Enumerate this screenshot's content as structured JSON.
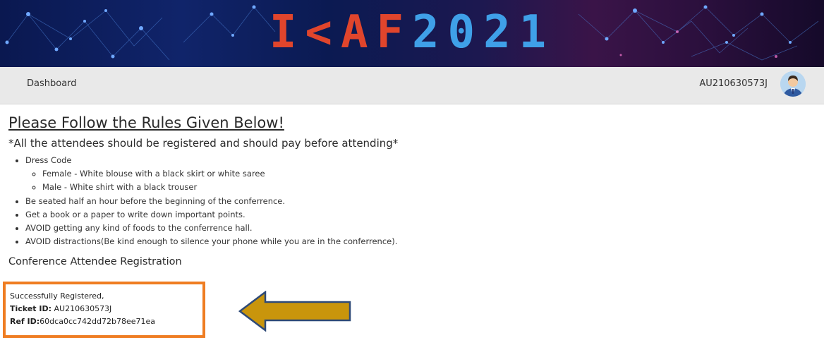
{
  "banner": {
    "title_part1": "I<AF",
    "title_part2": "2021"
  },
  "navbar": {
    "dashboard_label": "Dashboard",
    "user_id": "AU210630573J"
  },
  "rules": {
    "title": "Please Follow the Rules Given Below!",
    "subtitle": "*All the attendees should be registered and should pay before attending*",
    "items": [
      "Dress Code",
      "Be seated half an hour before the beginning of the conferrence.",
      "Get a book or a paper to write down important points.",
      "AVOID getting any kind of foods to the conferrence hall.",
      "AVOID distractions(Be kind enough to silence your phone while you are in the conferrence)."
    ],
    "dress_code": [
      "Female - White blouse with a black skirt or white saree",
      "Male - White shirt with a black trouser"
    ]
  },
  "registration": {
    "title": "Conference Attendee Registration",
    "success_text": "Successfully Registered,",
    "ticket_label": "Ticket ID:",
    "ticket_value": " AU210630573J",
    "ref_label": "Ref ID:",
    "ref_value": "60dca0cc742dd72b78ee71ea"
  },
  "colors": {
    "highlight_box": "#ef7d22",
    "arrow_fill": "#c9950c",
    "arrow_stroke": "#2e4a78"
  },
  "icons": {
    "avatar": "user-avatar-icon",
    "arrow": "left-arrow-icon"
  }
}
